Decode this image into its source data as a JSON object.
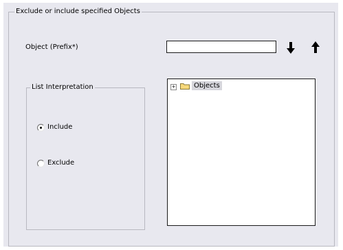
{
  "filter_panel": {
    "group_title": "Exclude or include specified Objects",
    "object_label": "Object (Prefix*)",
    "object_value": "",
    "list_interpretation": {
      "title": "List Interpretation",
      "options": [
        {
          "label": "Include",
          "selected": true
        },
        {
          "label": "Exclude",
          "selected": false
        }
      ]
    },
    "tree": {
      "root_label": "Objects",
      "expander_symbol": "+",
      "expanded": false
    },
    "icons": {
      "move_down": "arrow-down-icon",
      "move_up": "arrow-up-icon",
      "folder": "folder-icon"
    },
    "colors": {
      "panel_background": "#e8e8ef",
      "group_border": "#b8b8c0",
      "folder_fill": "#f6d87a",
      "selection_highlight": "#d6d6dc"
    }
  }
}
